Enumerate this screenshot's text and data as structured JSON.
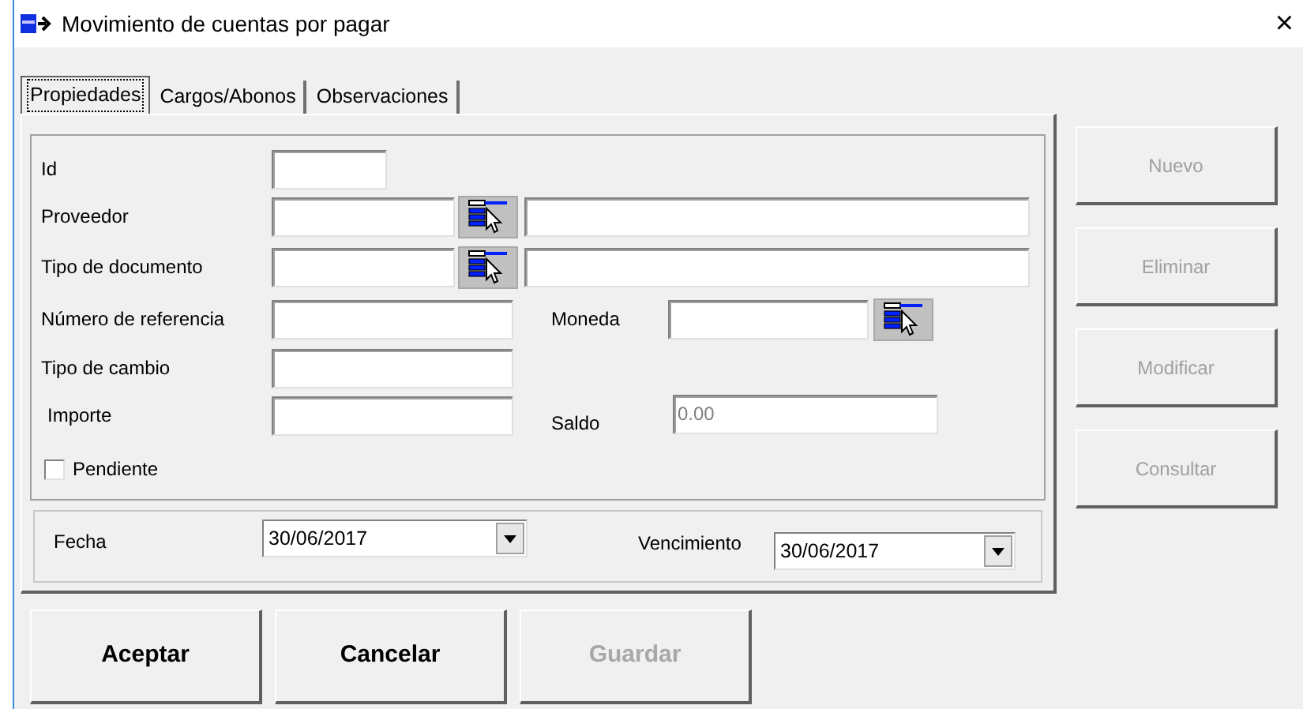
{
  "window": {
    "title": "Movimiento de cuentas por pagar",
    "close": "×"
  },
  "tabs": [
    {
      "label": "Propiedades",
      "selected": true
    },
    {
      "label": "Cargos/Abonos",
      "selected": false
    },
    {
      "label": "Observaciones",
      "selected": false
    }
  ],
  "rows": [
    {
      "kind": "short",
      "label": "Id"
    },
    {
      "kind": "lookup",
      "label": "Proveedor"
    },
    {
      "kind": "lookup",
      "label": "Tipo de documento"
    },
    {
      "kind": "pair-lookup",
      "label": "Número de referencia",
      "side_label": "Moneda"
    },
    {
      "kind": "plain",
      "label": "Tipo de cambio"
    },
    {
      "kind": "pair",
      "label": "Importe",
      "side_label": "Saldo",
      "side_value": "0.00",
      "side_disabled": true
    }
  ],
  "pendiente": {
    "label": "Pendiente",
    "checked": false
  },
  "dates": [
    {
      "label": "Fecha",
      "value": "30/06/2017"
    },
    {
      "label": "Vencimiento",
      "value": "30/06/2017"
    }
  ],
  "side_buttons": [
    {
      "label": "Nuevo",
      "disabled": true
    },
    {
      "label": "Eliminar",
      "disabled": true
    },
    {
      "label": "Modificar",
      "disabled": true
    },
    {
      "label": "Consultar",
      "disabled": true
    }
  ],
  "buttons": [
    {
      "label": "Aceptar",
      "disabled": false
    },
    {
      "label": "Cancelar",
      "disabled": false
    },
    {
      "label": "Guardar",
      "disabled": true
    }
  ]
}
